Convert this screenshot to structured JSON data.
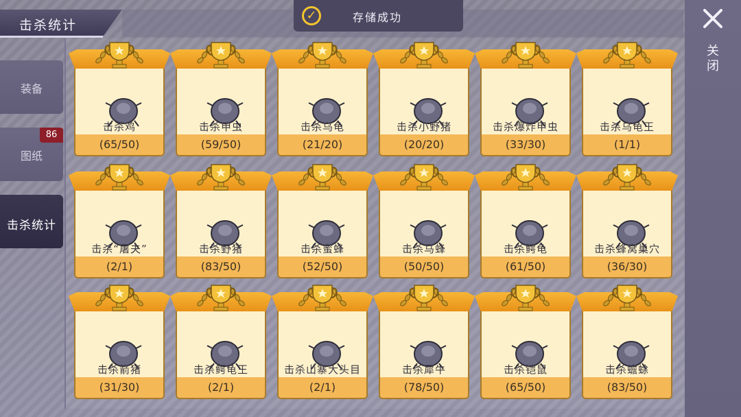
{
  "title": "击杀统计",
  "toast": {
    "message": "存储成功",
    "icon": "check-circle-icon"
  },
  "sidebar": {
    "items": [
      {
        "label": "装备",
        "badge": ""
      },
      {
        "label": "图纸",
        "badge": "86"
      },
      {
        "label": "击杀统计",
        "badge": "",
        "active": true
      }
    ]
  },
  "close": {
    "label": "关闭",
    "icon": "close-icon"
  },
  "colors": {
    "ribbon": "#f0a42a",
    "card": "#fdf1cb",
    "count_bar": "#f4b857",
    "accent": "#f4c430"
  },
  "cards": [
    {
      "name": "击杀鸡",
      "count": "(65/50)",
      "icon": "chicken-icon"
    },
    {
      "name": "击杀甲虫",
      "count": "(59/50)",
      "icon": "beetle-icon"
    },
    {
      "name": "击杀乌龟",
      "count": "(21/20)",
      "icon": "turtle-icon"
    },
    {
      "name": "击杀小野猪",
      "count": "(20/20)",
      "icon": "small-boar-icon"
    },
    {
      "name": "击杀爆炸甲虫",
      "count": "(33/30)",
      "icon": "explosive-beetle-icon"
    },
    {
      "name": "击杀乌龟王",
      "count": "(1/1)",
      "icon": "turtle-king-icon"
    },
    {
      "name": "击杀“屠夫”",
      "count": "(2/1)",
      "icon": "butcher-icon"
    },
    {
      "name": "击杀野猪",
      "count": "(83/50)",
      "icon": "boar-icon"
    },
    {
      "name": "击杀蜜蜂",
      "count": "(52/50)",
      "icon": "bee-icon"
    },
    {
      "name": "击杀马蜂",
      "count": "(50/50)",
      "icon": "wasp-icon"
    },
    {
      "name": "击杀鳄龟",
      "count": "(61/50)",
      "icon": "snapping-turtle-icon"
    },
    {
      "name": "击杀蜂窝巢穴",
      "count": "(36/30)",
      "icon": "hive-icon"
    },
    {
      "name": "击杀箭猪",
      "count": "(31/30)",
      "icon": "porcupine-icon"
    },
    {
      "name": "击杀鳄龟王",
      "count": "(2/1)",
      "icon": "snapping-turtle-king-icon"
    },
    {
      "name": "击杀山寨大头目",
      "count": "(2/1)",
      "icon": "bandit-chief-icon"
    },
    {
      "name": "击杀犀牛",
      "count": "(78/50)",
      "icon": "rhino-icon"
    },
    {
      "name": "击杀铠鼠",
      "count": "(65/50)",
      "icon": "armadillo-icon"
    },
    {
      "name": "击杀蟾蜍",
      "count": "(83/50)",
      "icon": "toad-icon"
    }
  ]
}
